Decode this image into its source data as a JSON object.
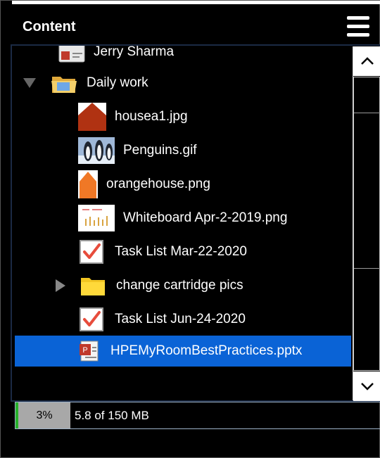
{
  "panel": {
    "title": "Content",
    "menu_icon": "hamburger-menu-icon"
  },
  "tree": {
    "items": [
      {
        "label": "Jerry Sharma",
        "icon": "contact-card-icon"
      },
      {
        "label": "Daily work",
        "icon": "folder-icon",
        "expanded": true
      },
      {
        "label": "housea1.jpg",
        "icon": "image-thumbnail-icon"
      },
      {
        "label": "Penguins.gif",
        "icon": "image-thumbnail-icon"
      },
      {
        "label": "orangehouse.png",
        "icon": "image-thumbnail-icon"
      },
      {
        "label": "Whiteboard Apr-2-2019.png",
        "icon": "image-thumbnail-icon"
      },
      {
        "label": "Task List Mar-22-2020",
        "icon": "task-list-icon"
      },
      {
        "label": "change cartridge pics",
        "icon": "folder-icon",
        "expanded": false
      },
      {
        "label": "Task List Jun-24-2020",
        "icon": "task-list-icon"
      },
      {
        "label": "HPEMyRoomBestPractices.pptx",
        "icon": "pptx-file-icon",
        "selected": true
      }
    ]
  },
  "scrollbar": {
    "up_icon": "chevron-up-icon",
    "down_icon": "chevron-down-icon"
  },
  "storage": {
    "percent_label": "3%",
    "percent_used": 3,
    "usage_text": "5.8 of 150 MB",
    "bar_color": "#27b02a"
  },
  "colors": {
    "selection": "#0a63d6",
    "background": "#000000"
  }
}
